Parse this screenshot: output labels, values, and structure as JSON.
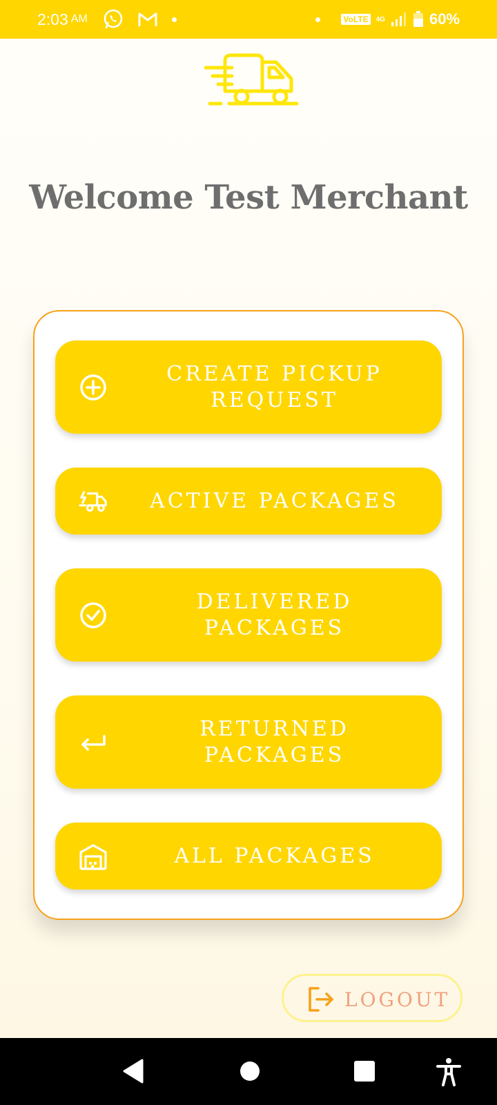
{
  "status_bar": {
    "time": "2:03",
    "ampm": "AM",
    "volte": "VoLTE",
    "network": "4G",
    "battery": "60%"
  },
  "welcome": "Welcome Test Merchant",
  "menu": {
    "create_pickup": "CREATE PICKUP REQUEST",
    "active_packages": "ACTIVE PACKAGES",
    "delivered_packages": "DELIVERED PACKAGES",
    "returned_packages": "RETURNED PACKAGES",
    "all_packages": "ALL PACKAGES"
  },
  "logout_label": "LOGOUT",
  "icons": {
    "logo": "delivery-truck-icon",
    "create_pickup": "plus-circle-icon",
    "active_packages": "fast-truck-icon",
    "delivered_packages": "check-circle-icon",
    "returned_packages": "return-arrow-icon",
    "all_packages": "warehouse-icon",
    "logout": "logout-icon"
  },
  "colors": {
    "primary": "#ffd600",
    "card_border": "#f7a11a",
    "welcome_text": "#6e6e6e",
    "logout_text": "#f0a07c",
    "logout_border": "#fdf28e"
  }
}
